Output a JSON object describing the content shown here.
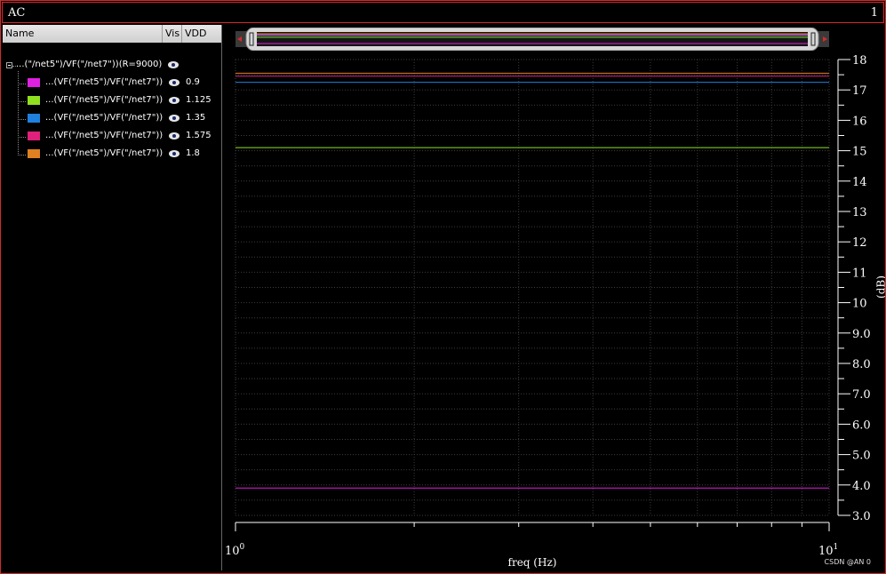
{
  "window": {
    "title": "AC",
    "page_number": "1",
    "watermark": "CSDN @AN 0"
  },
  "legend_panel": {
    "columns": [
      "Name",
      "Vis",
      "VDD"
    ],
    "group": {
      "label": "...(\"/net5\")/VF(\"/net7\"))(R=9000)",
      "icon": "eye-icon"
    },
    "items": [
      {
        "label": "...(VF(\"/net5\")/VF(\"/net7\"))",
        "vdd": "0.9",
        "color": "#e020e0",
        "icon": "eye-icon"
      },
      {
        "label": "...(VF(\"/net5\")/VF(\"/net7\"))",
        "vdd": "1.125",
        "color": "#90e020",
        "icon": "eye-icon"
      },
      {
        "label": "...(VF(\"/net5\")/VF(\"/net7\"))",
        "vdd": "1.35",
        "color": "#2080e0",
        "icon": "eye-icon"
      },
      {
        "label": "...(VF(\"/net5\")/VF(\"/net7\"))",
        "vdd": "1.575",
        "color": "#e0207a",
        "icon": "eye-icon"
      },
      {
        "label": "...(VF(\"/net5\")/VF(\"/net7\"))",
        "vdd": "1.8",
        "color": "#e08020",
        "icon": "eye-icon"
      }
    ]
  },
  "chart_data": {
    "type": "line",
    "xlabel": "freq (Hz)",
    "ylabel": "(dB)",
    "x_scale": "log",
    "xlim": [
      1,
      10
    ],
    "x_tick_labels": [
      {
        "base": "10",
        "exp": "0"
      },
      {
        "base": "10",
        "exp": "1"
      }
    ],
    "ylim": [
      3.0,
      18
    ],
    "y_ticks": [
      3.0,
      4.0,
      5.0,
      6.0,
      7.0,
      8.0,
      9.0,
      10,
      11,
      12,
      13,
      14,
      15,
      16,
      17,
      18
    ],
    "y_tick_labels": [
      "3.0",
      "4.0",
      "5.0",
      "6.0",
      "7.0",
      "8.0",
      "9.0",
      "10",
      "11",
      "12",
      "13",
      "14",
      "15",
      "16",
      "17",
      "18"
    ],
    "grid": true,
    "series": [
      {
        "vdd": "0.9",
        "color": "#e020e0",
        "x": [
          1,
          10
        ],
        "y": [
          3.9,
          3.9
        ]
      },
      {
        "vdd": "1.125",
        "color": "#90e020",
        "x": [
          1,
          10
        ],
        "y": [
          15.1,
          15.1
        ]
      },
      {
        "vdd": "1.35",
        "color": "#2080e0",
        "x": [
          1,
          10
        ],
        "y": [
          17.25,
          17.25
        ]
      },
      {
        "vdd": "1.575",
        "color": "#e0207a",
        "x": [
          1,
          10
        ],
        "y": [
          17.45,
          17.45
        ]
      },
      {
        "vdd": "1.8",
        "color": "#e08020",
        "x": [
          1,
          10
        ],
        "y": [
          17.55,
          17.55
        ]
      }
    ]
  }
}
